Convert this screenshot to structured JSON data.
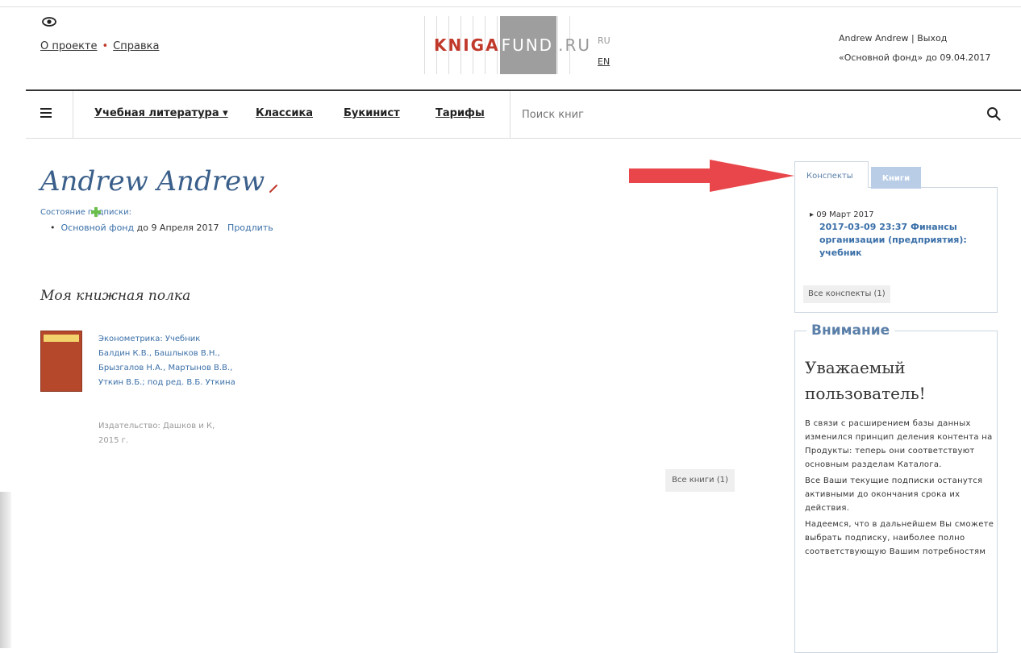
{
  "header": {
    "about_link": "О проекте",
    "help_link": "Справка",
    "logo": {
      "part1": "KNIGA",
      "part2": "FUND",
      "part3": ".RU"
    },
    "lang_ru": "RU",
    "lang_en": "EN",
    "user_line": "Andrew Andrew | Выход",
    "subscription_line": "«Основной фонд» до 09.04.2017"
  },
  "nav": {
    "items": [
      "Учебная литература ▾",
      "Классика",
      "Букинист",
      "Тарифы"
    ],
    "search_placeholder": "Поиск книг"
  },
  "profile": {
    "name": "Andrew Andrew",
    "subscription_state_label": "Состояние подписки:",
    "subscription_link": "Основной фонд",
    "subscription_until": " до 9 Апреля 2017",
    "renew_link": "Продлить"
  },
  "shelf": {
    "title": "Моя книжная полка",
    "book": {
      "title": "Эконометрика: Учебник",
      "authors": "Балдин К.В., Башлыков В.Н., Брызгалов Н.А., Мартынов В.В., Уткин В.Б.; под ред. В.Б. Уткина",
      "publisher": "Издательство: Дашков и К,",
      "year": "2015 г."
    },
    "all_books_button": "Все книги (1)"
  },
  "sidebar": {
    "tab_notes": "Конспекты",
    "tab_books": "Книги",
    "note_date": "09 Март 2017",
    "note_title": "2017-03-09 23:37 Финансы организации (предприятия): учебник",
    "all_notes_button": "Все конспекты (1)",
    "attention_title": "Внимание",
    "attention_heading": "Уважаемый пользователь!",
    "attention_p1": "В связи с расширением базы данных изменился принцип деления контента на Продукты: теперь они соответствуют основным разделам Каталога.",
    "attention_p2": "Все Ваши текущие подписки останутся активными до окончания срока их действия.",
    "attention_p3": "Надеемся, что в дальнейшем Вы сможете выбрать подписку, наиболее полно соответствующую Вашим потребностям"
  },
  "colors": {
    "accent": "#3a6fa8",
    "logo_red": "#c0392b",
    "arrow_red": "#e8464a"
  }
}
